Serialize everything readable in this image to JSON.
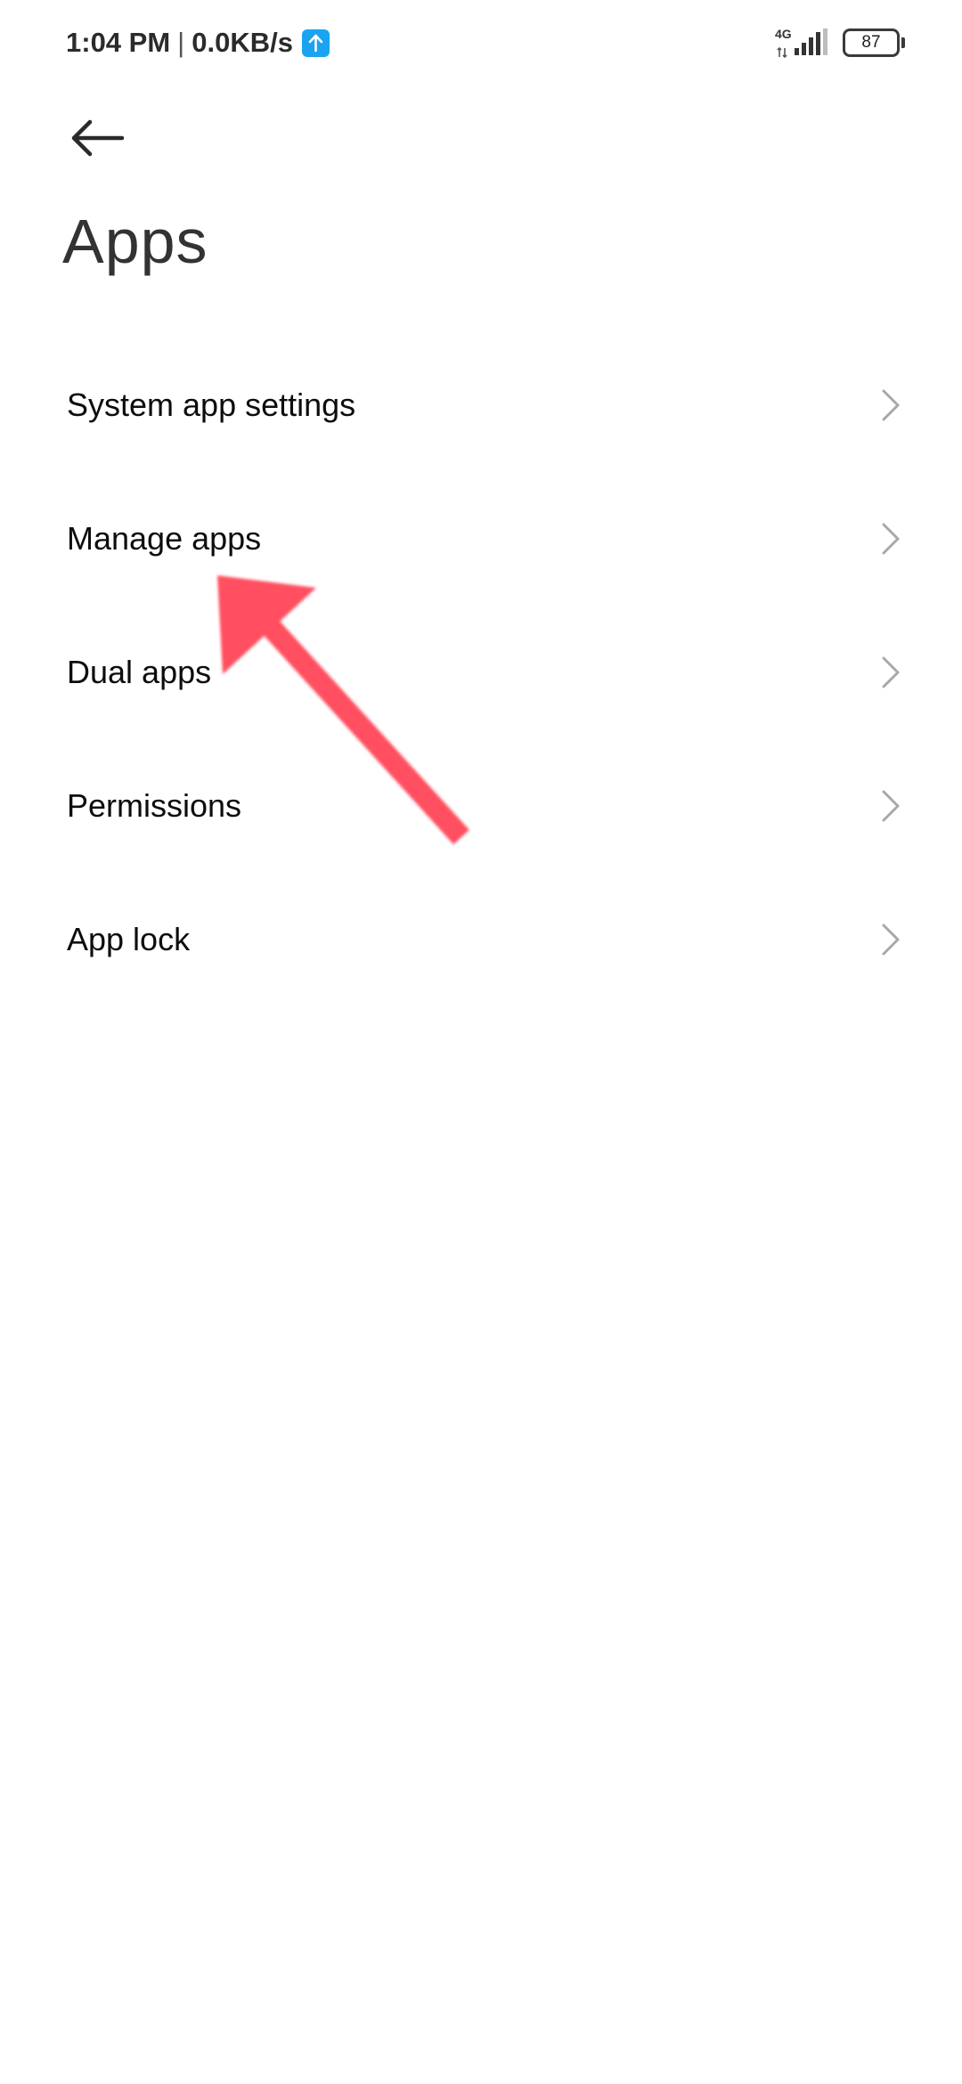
{
  "status_bar": {
    "time": "1:04 PM",
    "separator": "|",
    "net_speed": "0.0KB/s",
    "network_type": "4G",
    "battery_level": "87",
    "upload_icon": "upload-arrow-icon",
    "upload_color": "#1aa3f0"
  },
  "header": {
    "back_icon": "back-arrow-icon",
    "title": "Apps"
  },
  "menu": {
    "items": [
      {
        "label": "System app settings",
        "icon": "chevron-right-icon"
      },
      {
        "label": "Manage apps",
        "icon": "chevron-right-icon"
      },
      {
        "label": "Dual apps",
        "icon": "chevron-right-icon"
      },
      {
        "label": "Permissions",
        "icon": "chevron-right-icon"
      },
      {
        "label": "App lock",
        "icon": "chevron-right-icon"
      }
    ]
  },
  "annotation": {
    "icon": "pointer-arrow-icon",
    "color": "#ff5060"
  },
  "colors": {
    "background": "#ffffff",
    "chevron": "#a8a8a8",
    "title": "#333333"
  }
}
